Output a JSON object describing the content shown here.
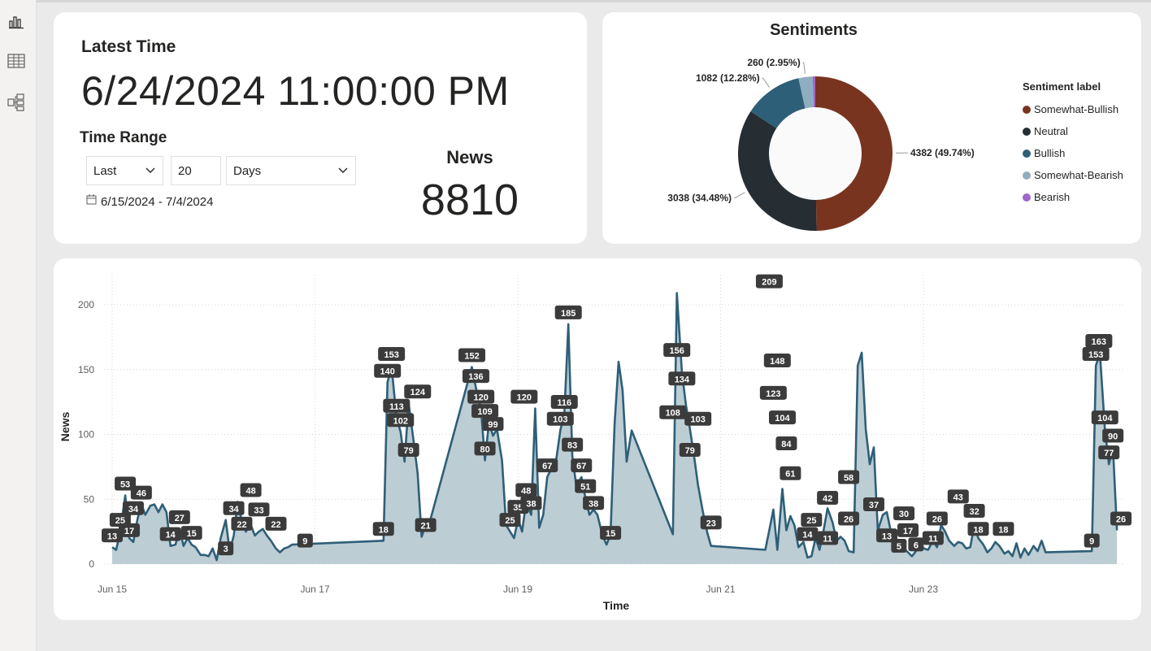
{
  "latest": {
    "label": "Latest Time",
    "value": "6/24/2024 11:00:00 PM"
  },
  "range": {
    "label": "Time Range",
    "relative": "Last",
    "amount": "20",
    "unit": "Days",
    "dates": "6/15/2024 - 7/4/2024"
  },
  "news": {
    "label": "News",
    "value": "8810"
  },
  "sentiments": {
    "title": "Sentiments",
    "legend_title": "Sentiment label",
    "slices": [
      {
        "name": "Somewhat-Bullish",
        "value": 4382,
        "label": "4382 (49.74%)",
        "color": "#79341f"
      },
      {
        "name": "Neutral",
        "value": 3038,
        "label": "3038 (34.48%)",
        "color": "#262e33"
      },
      {
        "name": "Bullish",
        "value": 1082,
        "label": "1082 (12.28%)",
        "color": "#2e5f78"
      },
      {
        "name": "Somewhat-Bearish",
        "value": 260,
        "label": "260 (2.95%)",
        "color": "#8eaec0"
      },
      {
        "name": "Bearish",
        "value": 48,
        "label": "",
        "color": "#a066c8"
      }
    ]
  },
  "chart_data": [
    {
      "type": "pie",
      "title": "Sentiments",
      "categories": [
        "Somewhat-Bullish",
        "Neutral",
        "Bullish",
        "Somewhat-Bearish",
        "Bearish"
      ],
      "values": [
        4382,
        3038,
        1082,
        260,
        48
      ]
    },
    {
      "type": "area",
      "title": "",
      "xlabel": "Time",
      "ylabel": "News",
      "ylim": [
        0,
        210
      ],
      "yticks": [
        0,
        50,
        100,
        150,
        200
      ],
      "xticks": [
        "Jun 15",
        "Jun 17",
        "Jun 19",
        "Jun 21",
        "Jun 23"
      ],
      "grid": true,
      "color": "#2e5f78",
      "fill": "#b9cad2",
      "x": [
        0.0,
        0.04,
        0.08,
        0.13,
        0.17,
        0.21,
        0.25,
        0.29,
        0.33,
        0.38,
        0.42,
        0.46,
        0.5,
        0.54,
        0.58,
        0.63,
        0.67,
        0.71,
        0.75,
        0.79,
        0.83,
        0.88,
        0.92,
        0.96,
        1.0,
        1.04,
        1.08,
        1.13,
        1.17,
        1.21,
        1.25,
        1.29,
        1.33,
        1.38,
        1.42,
        1.46,
        1.5,
        1.54,
        1.58,
        1.63,
        1.67,
        1.71,
        1.75,
        1.79,
        2.7,
        2.74,
        2.78,
        2.83,
        2.87,
        2.91,
        2.95,
        3.0,
        3.04,
        3.08,
        3.12,
        3.17,
        3.58,
        3.62,
        3.67,
        3.71,
        3.75,
        3.79,
        3.83,
        3.88,
        3.92,
        3.96,
        4.0,
        4.04,
        4.08,
        4.12,
        4.17,
        4.21,
        4.25,
        4.29,
        4.33,
        4.38,
        4.42,
        4.46,
        4.5,
        4.54,
        4.58,
        4.62,
        4.67,
        4.71,
        4.75,
        4.79,
        4.83,
        4.88,
        4.92,
        4.96,
        5.0,
        5.04,
        5.08,
        5.12,
        5.17,
        5.58,
        5.62,
        5.67,
        5.71,
        5.75,
        5.79,
        5.83,
        5.88,
        5.92,
        5.96,
        6.5,
        6.54,
        6.58,
        6.62,
        6.67,
        6.71,
        6.75,
        6.79,
        6.83,
        6.88,
        6.92,
        6.96,
        7.0,
        7.04,
        7.08,
        7.12,
        7.17,
        7.21,
        7.25,
        7.29,
        7.33,
        7.38,
        7.42,
        7.46,
        7.5,
        7.54,
        7.58,
        7.62,
        7.67,
        7.71,
        7.75,
        7.79,
        7.83,
        7.88,
        7.92,
        7.96,
        8.0,
        8.04,
        8.08,
        8.12,
        8.17,
        8.21,
        8.25,
        8.29,
        8.33,
        8.38,
        8.42,
        8.46,
        8.5,
        8.54,
        8.58,
        8.62,
        8.67,
        8.71,
        8.75,
        8.79,
        8.83,
        8.88,
        8.92,
        8.96,
        9.0,
        9.04,
        9.08,
        9.12,
        9.17,
        9.21,
        9.25,
        9.29,
        9.75,
        9.79,
        9.83,
        9.88,
        9.92,
        9.96,
        10.0,
        10.04
      ],
      "y": [
        13,
        11,
        25,
        53,
        20,
        17,
        34,
        46,
        38,
        45,
        46,
        40,
        46,
        40,
        14,
        15,
        27,
        14,
        20,
        15,
        13,
        7,
        7,
        6,
        12,
        3,
        20,
        34,
        10,
        22,
        48,
        33,
        25,
        30,
        22,
        25,
        27,
        22,
        18,
        12,
        9,
        12,
        13,
        15,
        18,
        140,
        153,
        113,
        102,
        79,
        124,
        95,
        70,
        21,
        30,
        35,
        152,
        136,
        120,
        80,
        109,
        99,
        104,
        80,
        30,
        25,
        20,
        35,
        25,
        48,
        38,
        120,
        28,
        38,
        67,
        75,
        81,
        103,
        116,
        185,
        83,
        60,
        67,
        51,
        38,
        42,
        38,
        22,
        15,
        23,
        108,
        156,
        134,
        79,
        103,
        23,
        209,
        148,
        123,
        104,
        84,
        61,
        40,
        25,
        14,
        11,
        26,
        42,
        11,
        58,
        26,
        37,
        30,
        13,
        17,
        5,
        6,
        20,
        11,
        26,
        43,
        32,
        18,
        21,
        18,
        10,
        9,
        153,
        163,
        104,
        77,
        90,
        26,
        38,
        40,
        25,
        18,
        14,
        12,
        9,
        6,
        10,
        15,
        12,
        11,
        18,
        13,
        30,
        25,
        18,
        14,
        17,
        16,
        12,
        13,
        30,
        20,
        15,
        9,
        12,
        17,
        14,
        8,
        10,
        6,
        16,
        5,
        12,
        7,
        14,
        10,
        18,
        9,
        10,
        153,
        163,
        104,
        77,
        90,
        26
      ],
      "labels": [
        {
          "x": 0.0,
          "y": 13,
          "t": "13"
        },
        {
          "x": 0.08,
          "y": 25,
          "t": "25"
        },
        {
          "x": 0.13,
          "y": 53,
          "t": "53"
        },
        {
          "x": 0.17,
          "y": 17,
          "t": "17"
        },
        {
          "x": 0.21,
          "y": 34,
          "t": "34"
        },
        {
          "x": 0.29,
          "y": 46,
          "t": "46"
        },
        {
          "x": 0.58,
          "y": 14,
          "t": "14"
        },
        {
          "x": 0.67,
          "y": 27,
          "t": "27"
        },
        {
          "x": 0.79,
          "y": 15,
          "t": "15"
        },
        {
          "x": 1.13,
          "y": 3,
          "t": "3"
        },
        {
          "x": 1.21,
          "y": 34,
          "t": "34"
        },
        {
          "x": 1.29,
          "y": 22,
          "t": "22"
        },
        {
          "x": 1.38,
          "y": 48,
          "t": "48"
        },
        {
          "x": 1.46,
          "y": 33,
          "t": "33"
        },
        {
          "x": 1.63,
          "y": 22,
          "t": "22"
        },
        {
          "x": 1.92,
          "y": 9,
          "t": "9"
        },
        {
          "x": 2.7,
          "y": 18,
          "t": "18"
        },
        {
          "x": 2.74,
          "y": 140,
          "t": "140"
        },
        {
          "x": 2.78,
          "y": 153,
          "t": "153"
        },
        {
          "x": 2.83,
          "y": 113,
          "t": "113"
        },
        {
          "x": 2.87,
          "y": 102,
          "t": "102"
        },
        {
          "x": 2.95,
          "y": 79,
          "t": "79"
        },
        {
          "x": 3.04,
          "y": 124,
          "t": "124"
        },
        {
          "x": 3.12,
          "y": 21,
          "t": "21"
        },
        {
          "x": 3.58,
          "y": 152,
          "t": "152"
        },
        {
          "x": 3.62,
          "y": 136,
          "t": "136"
        },
        {
          "x": 3.67,
          "y": 120,
          "t": "120"
        },
        {
          "x": 3.71,
          "y": 109,
          "t": "109"
        },
        {
          "x": 3.79,
          "y": 99,
          "t": "99"
        },
        {
          "x": 3.71,
          "y": 80,
          "t": "80"
        },
        {
          "x": 3.96,
          "y": 25,
          "t": "25"
        },
        {
          "x": 4.04,
          "y": 35,
          "t": "35"
        },
        {
          "x": 4.12,
          "y": 48,
          "t": "48"
        },
        {
          "x": 4.17,
          "y": 38,
          "t": "38"
        },
        {
          "x": 4.1,
          "y": 120,
          "t": "120"
        },
        {
          "x": 4.33,
          "y": 67,
          "t": "67"
        },
        {
          "x": 4.46,
          "y": 103,
          "t": "103"
        },
        {
          "x": 4.5,
          "y": 116,
          "t": "116"
        },
        {
          "x": 4.54,
          "y": 185,
          "t": "185"
        },
        {
          "x": 4.58,
          "y": 83,
          "t": "83"
        },
        {
          "x": 4.67,
          "y": 67,
          "t": "67"
        },
        {
          "x": 4.71,
          "y": 51,
          "t": "51"
        },
        {
          "x": 4.79,
          "y": 38,
          "t": "38"
        },
        {
          "x": 4.96,
          "y": 15,
          "t": "15"
        },
        {
          "x": 5.58,
          "y": 108,
          "t": "108"
        },
        {
          "x": 5.62,
          "y": 156,
          "t": "156"
        },
        {
          "x": 5.67,
          "y": 134,
          "t": "134"
        },
        {
          "x": 5.75,
          "y": 79,
          "t": "79"
        },
        {
          "x": 5.83,
          "y": 103,
          "t": "103"
        },
        {
          "x": 5.96,
          "y": 23,
          "t": "23"
        },
        {
          "x": 6.54,
          "y": 209,
          "t": "209"
        },
        {
          "x": 6.62,
          "y": 148,
          "t": "148"
        },
        {
          "x": 6.58,
          "y": 123,
          "t": "123"
        },
        {
          "x": 6.67,
          "y": 104,
          "t": "104"
        },
        {
          "x": 6.71,
          "y": 84,
          "t": "84"
        },
        {
          "x": 6.75,
          "y": 61,
          "t": "61"
        },
        {
          "x": 6.96,
          "y": 25,
          "t": "25"
        },
        {
          "x": 6.92,
          "y": 14,
          "t": "14"
        },
        {
          "x": 7.12,
          "y": 11,
          "t": "11"
        },
        {
          "x": 7.12,
          "y": 42,
          "t": "42"
        },
        {
          "x": 7.33,
          "y": 26,
          "t": "26"
        },
        {
          "x": 7.33,
          "y": 58,
          "t": "58"
        },
        {
          "x": 7.58,
          "y": 37,
          "t": "37"
        },
        {
          "x": 7.71,
          "y": 13,
          "t": "13"
        },
        {
          "x": 7.88,
          "y": 30,
          "t": "30"
        },
        {
          "x": 7.92,
          "y": 17,
          "t": "17"
        },
        {
          "x": 7.83,
          "y": 5,
          "t": "5"
        },
        {
          "x": 8.0,
          "y": 6,
          "t": "6"
        },
        {
          "x": 8.17,
          "y": 11,
          "t": "11"
        },
        {
          "x": 8.21,
          "y": 26,
          "t": "26"
        },
        {
          "x": 8.42,
          "y": 43,
          "t": "43"
        },
        {
          "x": 8.58,
          "y": 32,
          "t": "32"
        },
        {
          "x": 8.62,
          "y": 18,
          "t": "18"
        },
        {
          "x": 8.87,
          "y": 18,
          "t": "18"
        },
        {
          "x": 9.75,
          "y": 9,
          "t": "9"
        },
        {
          "x": 9.79,
          "y": 153,
          "t": "153"
        },
        {
          "x": 9.82,
          "y": 163,
          "t": "163"
        },
        {
          "x": 9.88,
          "y": 104,
          "t": "104"
        },
        {
          "x": 9.92,
          "y": 77,
          "t": "77"
        },
        {
          "x": 9.96,
          "y": 90,
          "t": "90"
        },
        {
          "x": 10.04,
          "y": 26,
          "t": "26"
        }
      ]
    }
  ]
}
